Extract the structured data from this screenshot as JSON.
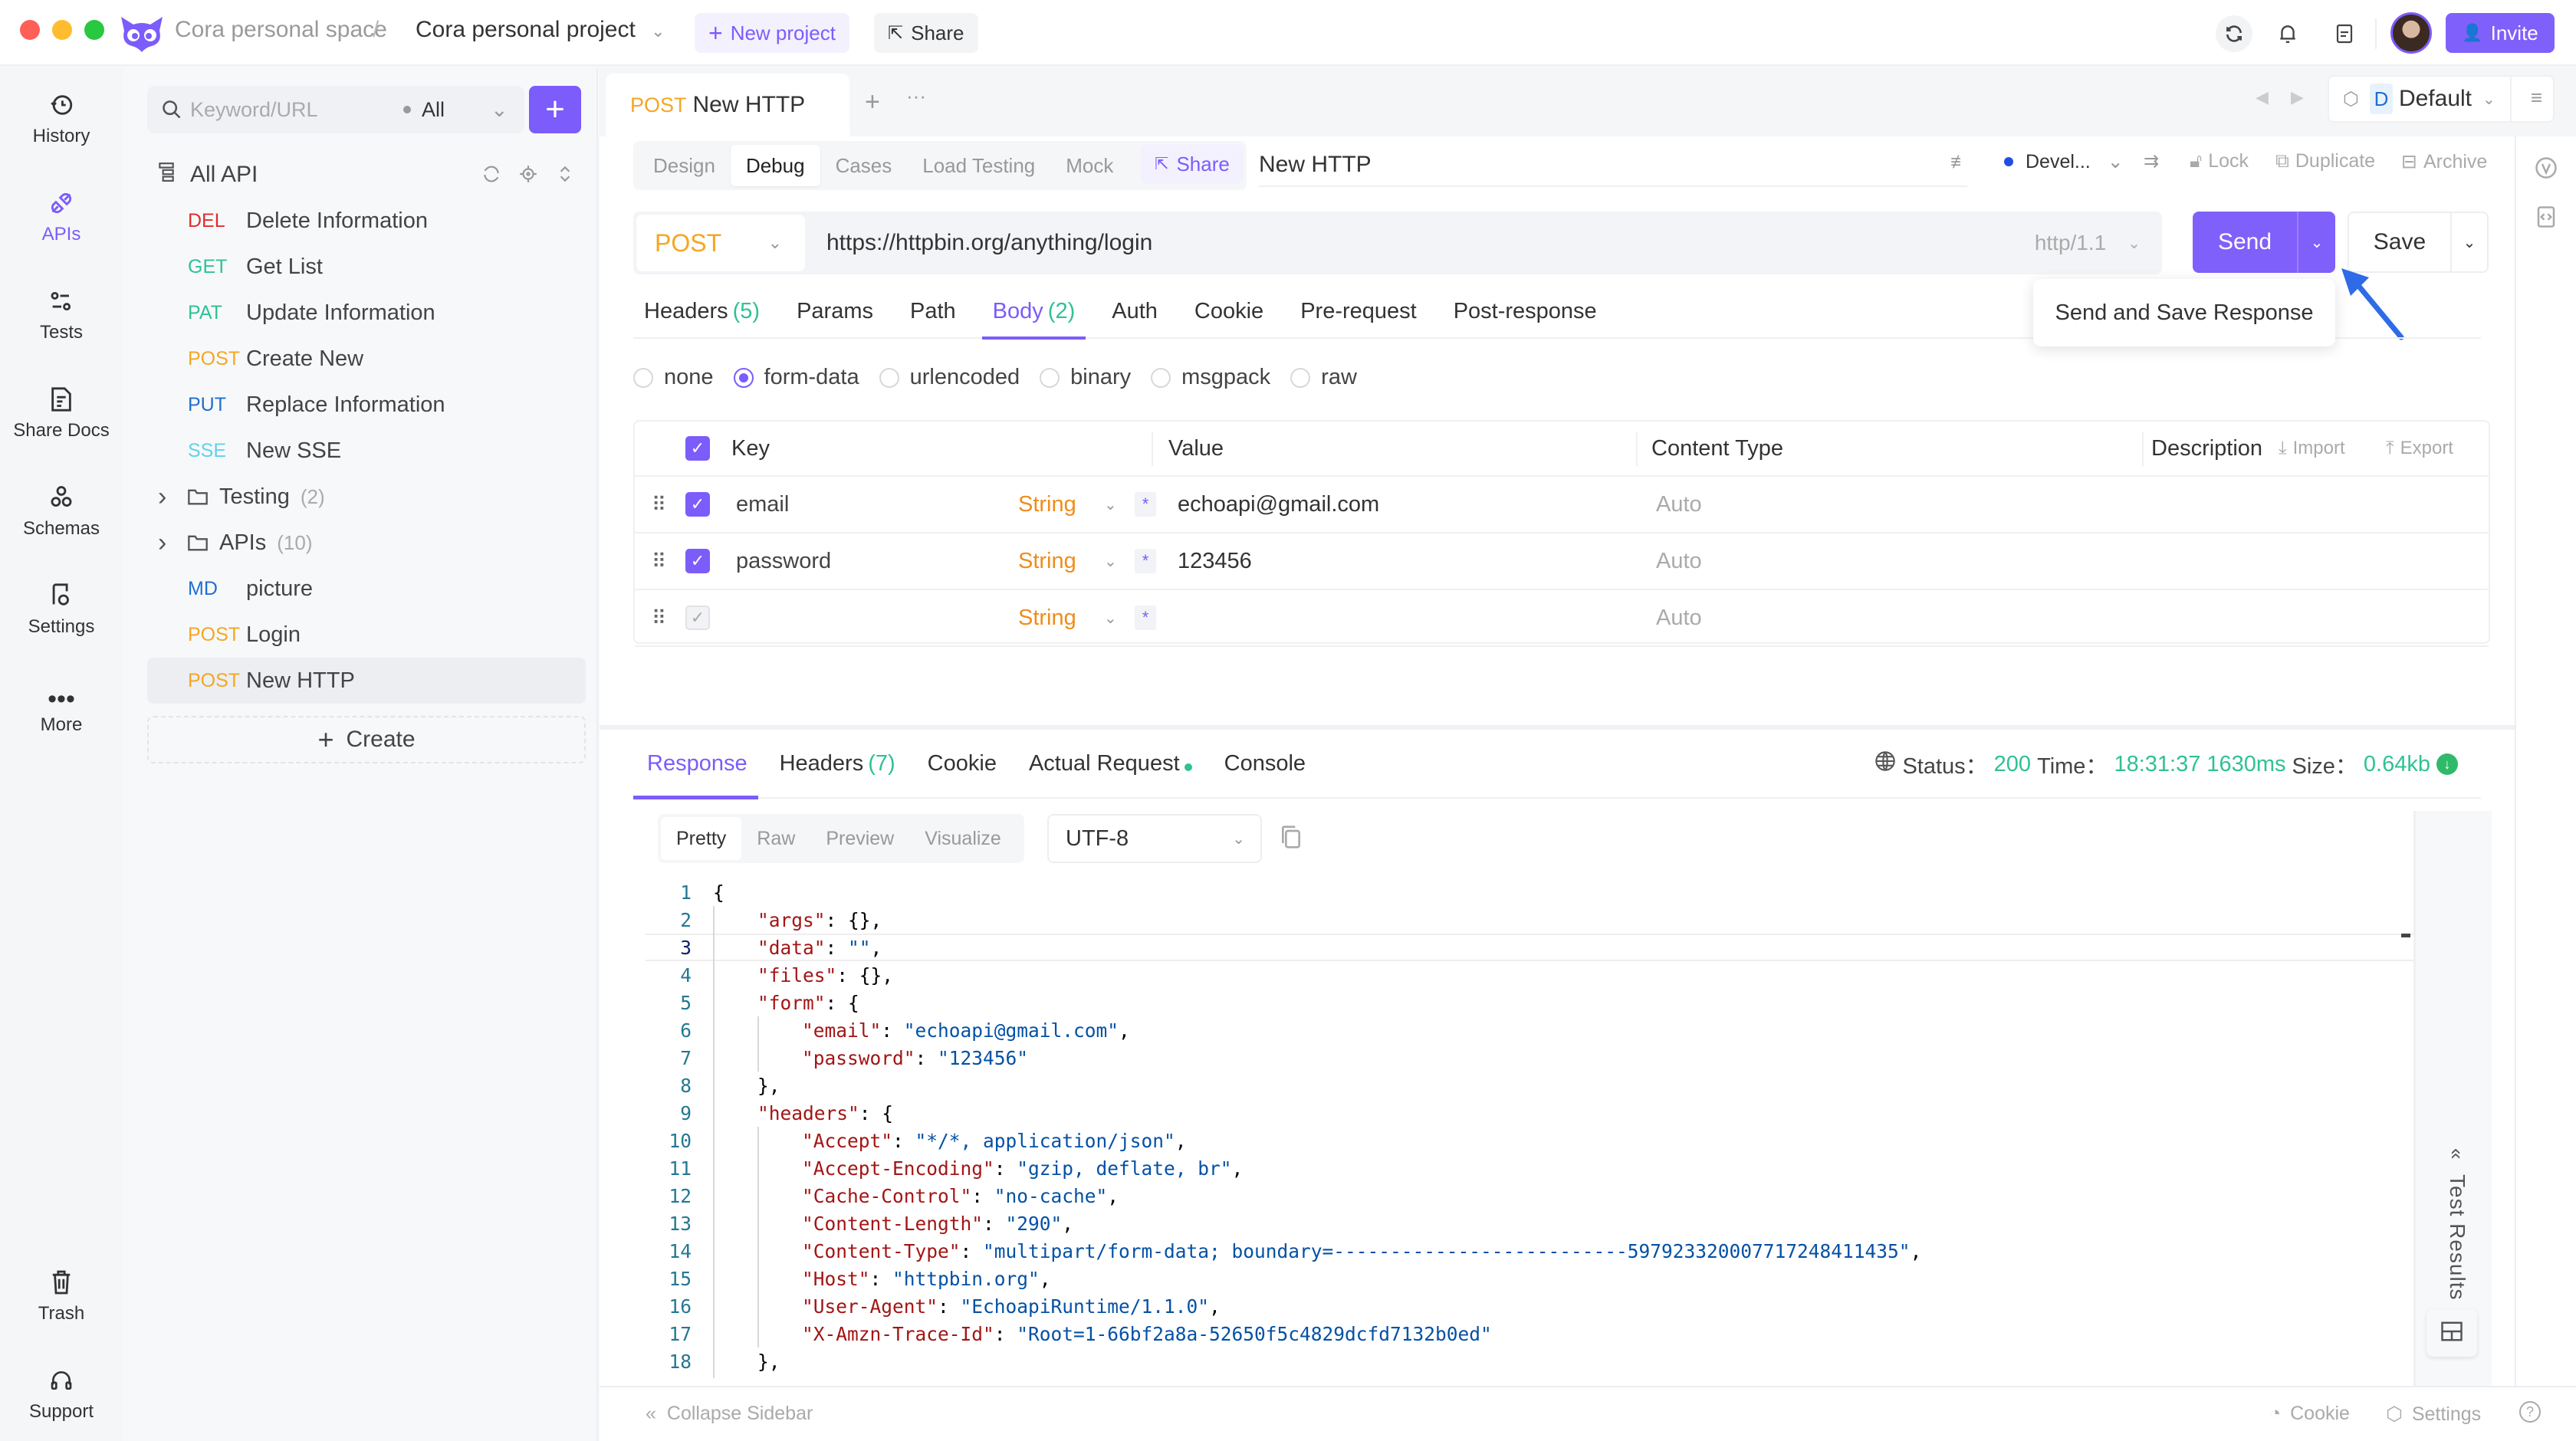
{
  "window": {
    "breadcrumb_space": "Cora personal space",
    "breadcrumb_sep": "/",
    "project": "Cora personal project",
    "new_project_label": "New project",
    "share_label": "Share",
    "invite_label": "Invite",
    "accent_color": "#7c5cfa"
  },
  "rail": {
    "items": [
      {
        "label": "History",
        "icon": "history-icon"
      },
      {
        "label": "APIs",
        "icon": "plug-icon",
        "active": true
      },
      {
        "label": "Tests",
        "icon": "tests-icon"
      },
      {
        "label": "Share Docs",
        "icon": "docs-icon"
      },
      {
        "label": "Schemas",
        "icon": "schemas-icon"
      },
      {
        "label": "Settings",
        "icon": "settings-icon"
      },
      {
        "label": "More",
        "icon": "more-icon"
      }
    ],
    "bottom": [
      {
        "label": "Trash",
        "icon": "trash-icon"
      },
      {
        "label": "Support",
        "icon": "headset-icon"
      }
    ]
  },
  "sidebar": {
    "search_placeholder": "Keyword/URL",
    "filter_value": "All",
    "root_label": "All API",
    "items": [
      {
        "method": "DEL",
        "name": "Delete Information",
        "color": "#e02d2d"
      },
      {
        "method": "GET",
        "name": "Get List",
        "color": "#2fc194"
      },
      {
        "method": "PAT",
        "name": "Update Information",
        "color": "#2fc194"
      },
      {
        "method": "POST",
        "name": "Create New",
        "color": "#f5a623"
      },
      {
        "method": "PUT",
        "name": "Replace Information",
        "color": "#1f6fd0"
      },
      {
        "method": "SSE",
        "name": "New SSE",
        "color": "#5ed3e8"
      }
    ],
    "folders": [
      {
        "name": "Testing",
        "count": "(2)"
      },
      {
        "name": "APIs",
        "count": "(10)"
      }
    ],
    "items_after": [
      {
        "method": "MD",
        "name": "picture",
        "color": "#1f6fd0"
      },
      {
        "method": "POST",
        "name": "Login",
        "color": "#f5a623"
      },
      {
        "method": "POST",
        "name": "New HTTP",
        "color": "#f5a623",
        "active": true
      }
    ],
    "create_label": "Create"
  },
  "tab": {
    "method": "POST",
    "name": "New HTTP",
    "env_badge": "D",
    "env_name": "Default"
  },
  "modes": [
    "Design",
    "Debug",
    "Cases",
    "Load Testing",
    "Mock"
  ],
  "active_mode": "Debug",
  "share_chip": "Share",
  "request": {
    "name": "New HTTP",
    "status_label": "Devel...",
    "lock_label": "Lock",
    "duplicate_label": "Duplicate",
    "archive_label": "Archive",
    "method": "POST",
    "url": "https://httpbin.org/anything/login",
    "http_version": "http/1.1",
    "send_label": "Send",
    "save_label": "Save",
    "send_menu_item": "Send and Save Response"
  },
  "subtabs": [
    {
      "label": "Headers",
      "count": "(5)"
    },
    {
      "label": "Params",
      "count": ""
    },
    {
      "label": "Path",
      "count": ""
    },
    {
      "label": "Body",
      "count": "(2)",
      "active": true
    },
    {
      "label": "Auth",
      "count": ""
    },
    {
      "label": "Cookie",
      "count": ""
    },
    {
      "label": "Pre-request",
      "count": ""
    },
    {
      "label": "Post-response",
      "count": ""
    }
  ],
  "body_types": [
    "none",
    "form-data",
    "urlencoded",
    "binary",
    "msgpack",
    "raw"
  ],
  "body_type_selected": "form-data",
  "table": {
    "headers": {
      "key": "Key",
      "value": "Value",
      "content_type": "Content Type",
      "description": "Description",
      "import": "Import",
      "export": "Export"
    },
    "rows": [
      {
        "key": "email",
        "type": "String",
        "value": "echoapi@gmail.com",
        "content_type": "Auto",
        "checked": true
      },
      {
        "key": "password",
        "type": "String",
        "value": "123456",
        "content_type": "Auto",
        "checked": true
      },
      {
        "key": "",
        "type": "String",
        "value": "",
        "content_type": "Auto",
        "checked": false
      }
    ]
  },
  "response": {
    "tabs": [
      {
        "label": "Response",
        "active": true
      },
      {
        "label": "Headers",
        "count": "(7)"
      },
      {
        "label": "Cookie"
      },
      {
        "label": "Actual Request",
        "dot": true
      },
      {
        "label": "Console"
      }
    ],
    "status_label": "Status：",
    "status": "200",
    "time_label": "Time：",
    "time": "18:31:37",
    "duration": "1630ms",
    "size_label": "Size：",
    "size": "0.64kb",
    "views": [
      "Pretty",
      "Raw",
      "Preview",
      "Visualize"
    ],
    "active_view": "Pretty",
    "encoding": "UTF-8",
    "test_results_label": "Test Results",
    "code_lines": [
      {
        "n": "1",
        "indent": 0,
        "parts": [
          [
            "p",
            "{"
          ]
        ]
      },
      {
        "n": "2",
        "indent": 1,
        "parts": [
          [
            "k",
            "\"args\""
          ],
          [
            "p",
            ": {},"
          ]
        ]
      },
      {
        "n": "3",
        "indent": 1,
        "parts": [
          [
            "k",
            "\"data\""
          ],
          [
            "p",
            ": "
          ],
          [
            "s",
            "\"\""
          ],
          [
            "p",
            ","
          ]
        ]
      },
      {
        "n": "4",
        "indent": 1,
        "parts": [
          [
            "k",
            "\"files\""
          ],
          [
            "p",
            ": {},"
          ]
        ]
      },
      {
        "n": "5",
        "indent": 1,
        "parts": [
          [
            "k",
            "\"form\""
          ],
          [
            "p",
            ": {"
          ]
        ]
      },
      {
        "n": "6",
        "indent": 2,
        "parts": [
          [
            "k",
            "\"email\""
          ],
          [
            "p",
            ": "
          ],
          [
            "s",
            "\"echoapi@gmail.com\""
          ],
          [
            "p",
            ","
          ]
        ]
      },
      {
        "n": "7",
        "indent": 2,
        "parts": [
          [
            "k",
            "\"password\""
          ],
          [
            "p",
            ": "
          ],
          [
            "s",
            "\"123456\""
          ]
        ]
      },
      {
        "n": "8",
        "indent": 1,
        "parts": [
          [
            "p",
            "},"
          ]
        ]
      },
      {
        "n": "9",
        "indent": 1,
        "parts": [
          [
            "k",
            "\"headers\""
          ],
          [
            "p",
            ": {"
          ]
        ]
      },
      {
        "n": "10",
        "indent": 2,
        "parts": [
          [
            "k",
            "\"Accept\""
          ],
          [
            "p",
            ": "
          ],
          [
            "s",
            "\"*/*, application/json\""
          ],
          [
            "p",
            ","
          ]
        ]
      },
      {
        "n": "11",
        "indent": 2,
        "parts": [
          [
            "k",
            "\"Accept-Encoding\""
          ],
          [
            "p",
            ": "
          ],
          [
            "s",
            "\"gzip, deflate, br\""
          ],
          [
            "p",
            ","
          ]
        ]
      },
      {
        "n": "12",
        "indent": 2,
        "parts": [
          [
            "k",
            "\"Cache-Control\""
          ],
          [
            "p",
            ": "
          ],
          [
            "s",
            "\"no-cache\""
          ],
          [
            "p",
            ","
          ]
        ]
      },
      {
        "n": "13",
        "indent": 2,
        "parts": [
          [
            "k",
            "\"Content-Length\""
          ],
          [
            "p",
            ": "
          ],
          [
            "s",
            "\"290\""
          ],
          [
            "p",
            ","
          ]
        ]
      },
      {
        "n": "14",
        "indent": 2,
        "parts": [
          [
            "k",
            "\"Content-Type\""
          ],
          [
            "p",
            ": "
          ],
          [
            "s",
            "\"multipart/form-data; boundary=--------------------------597923320007717248411435\""
          ],
          [
            "p",
            ","
          ]
        ]
      },
      {
        "n": "15",
        "indent": 2,
        "parts": [
          [
            "k",
            "\"Host\""
          ],
          [
            "p",
            ": "
          ],
          [
            "s",
            "\"httpbin.org\""
          ],
          [
            "p",
            ","
          ]
        ]
      },
      {
        "n": "16",
        "indent": 2,
        "parts": [
          [
            "k",
            "\"User-Agent\""
          ],
          [
            "p",
            ": "
          ],
          [
            "s",
            "\"EchoapiRuntime/1.1.0\""
          ],
          [
            "p",
            ","
          ]
        ]
      },
      {
        "n": "17",
        "indent": 2,
        "parts": [
          [
            "k",
            "\"X-Amzn-Trace-Id\""
          ],
          [
            "p",
            ": "
          ],
          [
            "s",
            "\"Root=1-66bf2a8a-52650f5c4829dcfd7132b0ed\""
          ]
        ]
      },
      {
        "n": "18",
        "indent": 1,
        "parts": [
          [
            "p",
            "},"
          ]
        ]
      }
    ]
  },
  "footer": {
    "collapse_label": "Collapse Sidebar",
    "cookie_label": "Cookie",
    "settings_label": "Settings"
  }
}
